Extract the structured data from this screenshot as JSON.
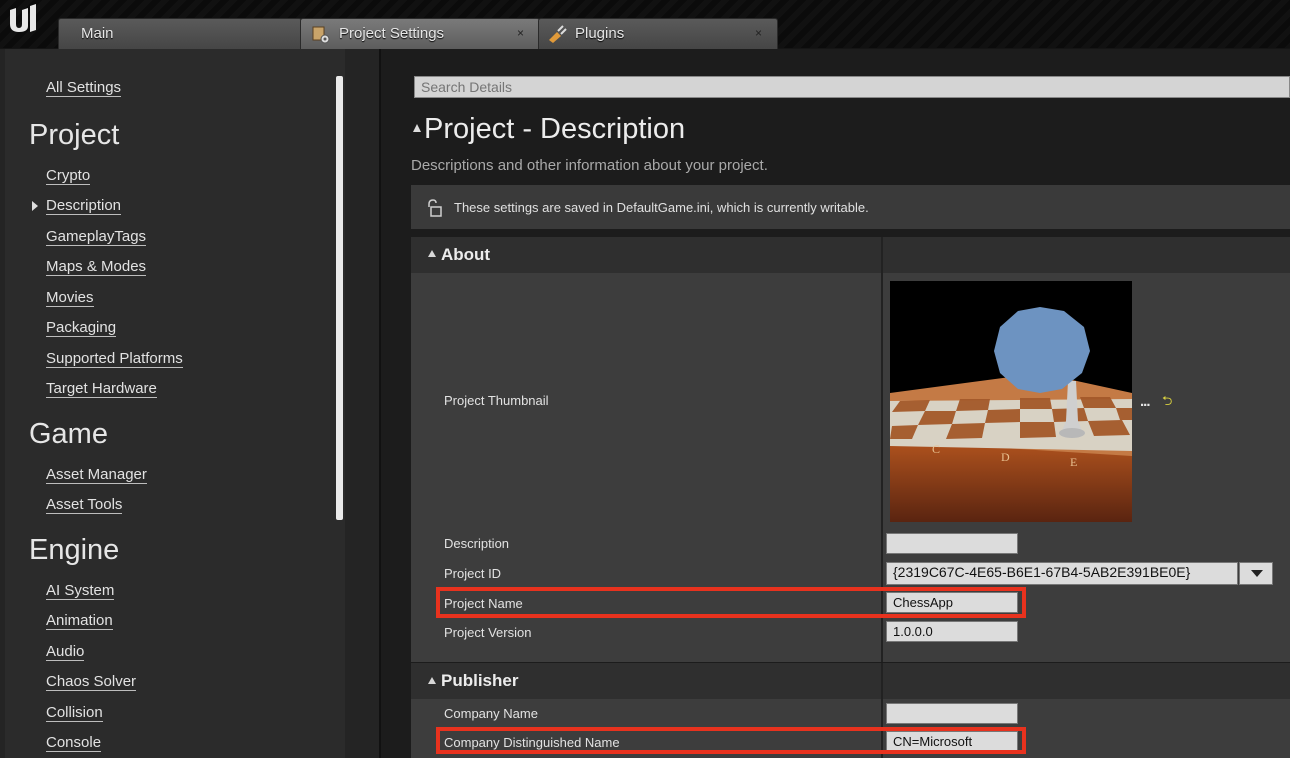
{
  "tabs": [
    {
      "label": "Main"
    },
    {
      "label": "Project Settings",
      "close": "×"
    },
    {
      "label": "Plugins",
      "close": "×"
    }
  ],
  "sidebar": {
    "all_settings": "All Settings",
    "project_heading": "Project",
    "project_items": [
      "Crypto",
      "Description",
      "GameplayTags",
      "Maps & Modes",
      "Movies",
      "Packaging",
      "Supported Platforms",
      "Target Hardware"
    ],
    "game_heading": "Game",
    "game_items": [
      "Asset Manager",
      "Asset Tools"
    ],
    "engine_heading": "Engine",
    "engine_items": [
      "AI System",
      "Animation",
      "Audio",
      "Chaos Solver",
      "Collision",
      "Console"
    ],
    "selected": "Description"
  },
  "search": {
    "placeholder": "Search Details"
  },
  "page": {
    "title": "Project - Description",
    "subtitle": "Descriptions and other information about your project.",
    "notice": "These settings are saved in DefaultGame.ini, which is currently writable."
  },
  "about": {
    "heading": "About",
    "thumbnail_label": "Project Thumbnail",
    "thumbnail_dots": "...",
    "board_letters": [
      "C",
      "D",
      "E"
    ],
    "description_label": "Description",
    "description_value": "",
    "project_id_label": "Project ID",
    "project_id_value": "{2319C67C-4E65-B6E1-67B4-5AB2E391BE0E}",
    "project_name_label": "Project Name",
    "project_name_value": "ChessApp",
    "project_version_label": "Project Version",
    "project_version_value": "1.0.0.0"
  },
  "publisher": {
    "heading": "Publisher",
    "company_name_label": "Company Name",
    "company_name_value": "",
    "company_dn_label": "Company Distinguished Name",
    "company_dn_value": "CN=Microsoft"
  },
  "colors": {
    "highlight": "#e8321e",
    "panel": "#3d3d3d",
    "category_header": "#2f2f2f"
  }
}
